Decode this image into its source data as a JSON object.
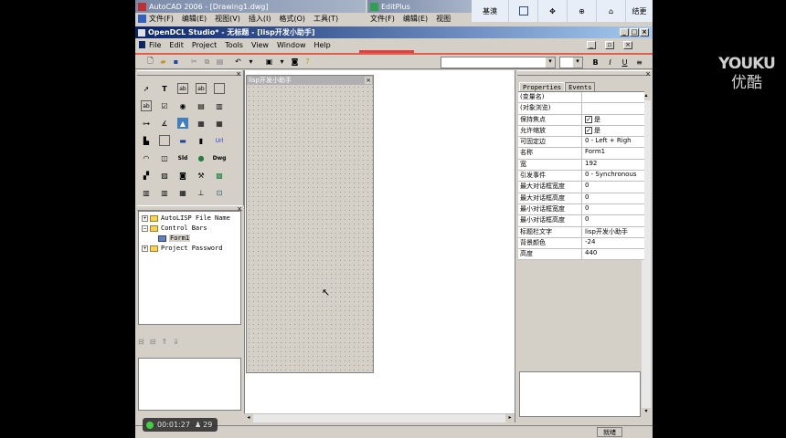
{
  "autocad_title": "AutoCAD 2006 - [Drawing1.dwg]",
  "autocad_menu": [
    "文件(F)",
    "编辑(E)",
    "视图(V)",
    "插入(I)",
    "格式(O)",
    "工具(T)"
  ],
  "editplus_title": "EditPlus",
  "editplus_menu": [
    "文件(F)",
    "编辑(E)",
    "视图"
  ],
  "overlay_buttons": [
    "基漠",
    "结更"
  ],
  "odcl_title": "OpenDCL Studio* - 无标题 - [lisp开发小助手]",
  "odcl_menu": [
    "File",
    "Edit",
    "Project",
    "Tools",
    "View",
    "Window",
    "Help"
  ],
  "format_buttons": [
    "B",
    "I",
    "U"
  ],
  "form_title": "lisp开发小助手",
  "tree": [
    {
      "label": "AutoLISP File Name",
      "expander": "+"
    },
    {
      "label": "Control Bars",
      "expander": "−"
    },
    {
      "label": "Form1",
      "expander": ""
    },
    {
      "label": "Project Password",
      "expander": "+"
    }
  ],
  "tabs": {
    "properties": "Properties",
    "events": "Events"
  },
  "properties": [
    {
      "k": "(变量名)",
      "v": ""
    },
    {
      "k": "(对象浏览)",
      "v": ""
    },
    {
      "k": "保持焦点",
      "v": "是",
      "check": true
    },
    {
      "k": "允许缩放",
      "v": "是",
      "check": true
    },
    {
      "k": "可固定边",
      "v": "0 - Left + Righ"
    },
    {
      "k": "名称",
      "v": "Form1"
    },
    {
      "k": "宽",
      "v": "192"
    },
    {
      "k": "引发事件",
      "v": "0 - Synchronous"
    },
    {
      "k": "最大对话框宽度",
      "v": "0"
    },
    {
      "k": "最大对话框高度",
      "v": "0"
    },
    {
      "k": "最小对话框宽度",
      "v": "0"
    },
    {
      "k": "最小对话框高度",
      "v": "0"
    },
    {
      "k": "标题栏文字",
      "v": "lisp开发小助手"
    },
    {
      "k": "背景颜色",
      "v": "-24"
    },
    {
      "k": "高度",
      "v": "440"
    }
  ],
  "status_text": "就绪",
  "recorder": {
    "time": "00:01:27",
    "count": "29"
  },
  "watermark": {
    "brand": "YOUKU",
    "cn": "优酷"
  }
}
